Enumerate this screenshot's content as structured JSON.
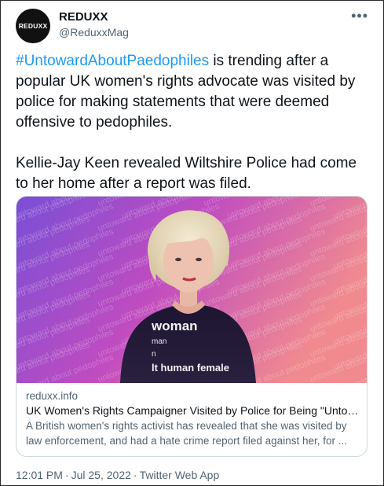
{
  "account": {
    "display_name": "REDUXX",
    "handle": "@ReduxxMag",
    "avatar_text": "REDUXX"
  },
  "more_label": "•••",
  "tweet": {
    "hashtag": "#UntowardAboutPaedophiles",
    "paragraph1_rest": " is trending after a popular UK women's rights advocate was visited by police for making statements that were deemed offensive to pedophiles.",
    "paragraph2": "Kellie-Jay Keen revealed Wiltshire Police had come to her home after a report was filed."
  },
  "card": {
    "domain": "reduxx.info",
    "title": "UK Women's Rights Campaigner Visited by Police for Being \"Untowa...",
    "description": "A British women's rights activist has revealed that she was visited by law enforcement, and had a hate crime report filed against her, for ...",
    "image": {
      "background_text": "untoward about pedophiles",
      "shirt_line1": "woman",
      "shirt_line2": "man",
      "shirt_line3": "n",
      "shirt_line4": "lt human female"
    }
  },
  "footer": {
    "time": "12:01 PM",
    "date": "Jul 25, 2022",
    "source": "Twitter Web App",
    "separator": "·"
  },
  "colors": {
    "hashtag": "#1d9bf0",
    "gradient_start": "#7a4fd6",
    "gradient_mid": "#c04cc0",
    "gradient_end": "#f08a8f"
  }
}
